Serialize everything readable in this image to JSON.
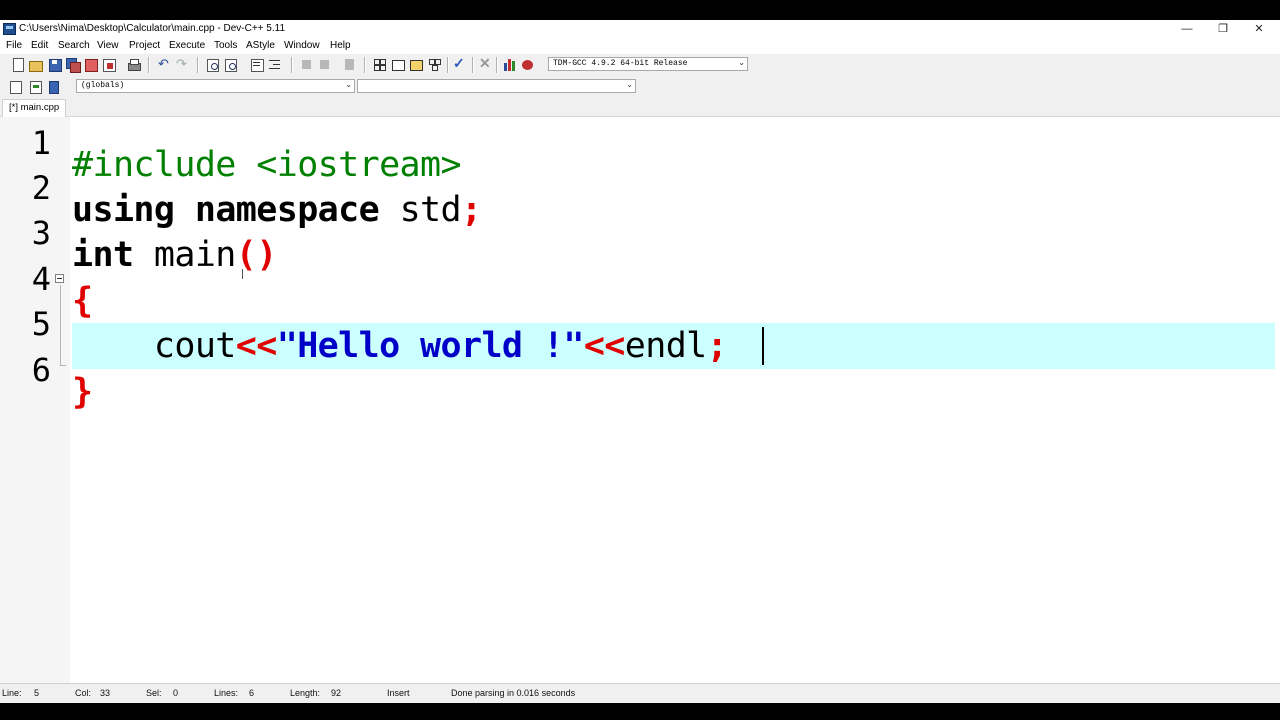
{
  "window": {
    "title": "C:\\Users\\Nima\\Desktop\\Calculator\\main.cpp - Dev-C++ 5.11",
    "minimize_glyph": "—",
    "maximize_glyph": "❐",
    "close_glyph": "✕"
  },
  "menu": [
    "File",
    "Edit",
    "Search",
    "View",
    "Project",
    "Execute",
    "Tools",
    "AStyle",
    "Window",
    "Help"
  ],
  "toolbar": {
    "compiler_select": "TDM-GCC 4.9.2 64-bit Release",
    "class_select": "(globals)",
    "member_select": ""
  },
  "tabs": [
    {
      "label": "[*] main.cpp"
    }
  ],
  "editor": {
    "line_numbers": [
      "1",
      "2",
      "3",
      "4",
      "5",
      "6"
    ],
    "lines": [
      [
        {
          "t": "#include <iostream>",
          "c": "pp"
        }
      ],
      [
        {
          "t": "using",
          "c": "kw"
        },
        {
          "t": " ",
          "c": "id"
        },
        {
          "t": "namespace",
          "c": "kw"
        },
        {
          "t": " std",
          "c": "id"
        },
        {
          "t": ";",
          "c": "sym"
        }
      ],
      [
        {
          "t": "int",
          "c": "kw"
        },
        {
          "t": " main",
          "c": "id"
        },
        {
          "t": "()",
          "c": "sym"
        }
      ],
      [
        {
          "t": "{",
          "c": "sym"
        }
      ],
      [
        {
          "t": "    cout",
          "c": "id"
        },
        {
          "t": "<<",
          "c": "sym"
        },
        {
          "t": "\"Hello world !\"",
          "c": "str"
        },
        {
          "t": "<<",
          "c": "sym"
        },
        {
          "t": "endl",
          "c": "id"
        },
        {
          "t": ";",
          "c": "sym"
        }
      ],
      [
        {
          "t": "}",
          "c": "sym"
        }
      ]
    ],
    "current_line": 5,
    "colors": {
      "current_line_bg": "#ccffff",
      "preprocessor": "#008000",
      "symbol": "#e00000",
      "string": "#0000c8"
    }
  },
  "status": {
    "line_label": "Line:",
    "line_value": "5",
    "col_label": "Col:",
    "col_value": "33",
    "sel_label": "Sel:",
    "sel_value": "0",
    "lines_label": "Lines:",
    "lines_value": "6",
    "length_label": "Length:",
    "length_value": "92",
    "mode": "Insert",
    "message": "Done parsing in 0.016 seconds"
  }
}
